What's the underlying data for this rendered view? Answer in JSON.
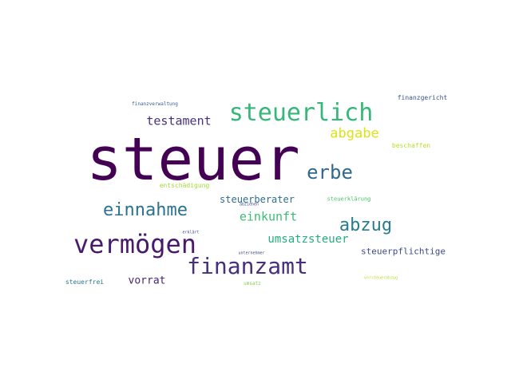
{
  "word_cloud": {
    "words": [
      {
        "text": "steuer",
        "color": "#440154"
      },
      {
        "text": "steuerlich",
        "color": "#35b779"
      },
      {
        "text": "vermögen",
        "color": "#481a6c"
      },
      {
        "text": "finanzamt",
        "color": "#472f7d"
      },
      {
        "text": "erbe",
        "color": "#31688e"
      },
      {
        "text": "einnahme",
        "color": "#2c728e"
      },
      {
        "text": "abzug",
        "color": "#287c8e"
      },
      {
        "text": "abgabe",
        "color": "#dde318"
      },
      {
        "text": "testament",
        "color": "#46327e"
      },
      {
        "text": "einkunft",
        "color": "#3bbb75"
      },
      {
        "text": "umsatzsteuer",
        "color": "#26ad81"
      },
      {
        "text": "steuerberater",
        "color": "#2f6c8e"
      },
      {
        "text": "steuerpflichtige",
        "color": "#3e4989"
      },
      {
        "text": "vorrat",
        "color": "#482475"
      },
      {
        "text": "finanzgericht",
        "color": "#3a548c"
      },
      {
        "text": "beschaffen",
        "color": "#b8de29"
      },
      {
        "text": "entschädigung",
        "color": "#a5db36"
      },
      {
        "text": "steuerklärung",
        "color": "#4ac16d"
      },
      {
        "text": "finanzverwaltung",
        "color": "#355f8d"
      },
      {
        "text": "steuerfrei",
        "color": "#2a788e"
      },
      {
        "text": "umsatz",
        "color": "#7ad151"
      },
      {
        "text": "vorsteuerabzug",
        "color": "#b5de2b"
      },
      {
        "text": "unternehmer",
        "color": "#3e4a89"
      },
      {
        "text": "abziehen",
        "color": "#3f4788"
      },
      {
        "text": "erklärt",
        "color": "#404688"
      }
    ]
  }
}
